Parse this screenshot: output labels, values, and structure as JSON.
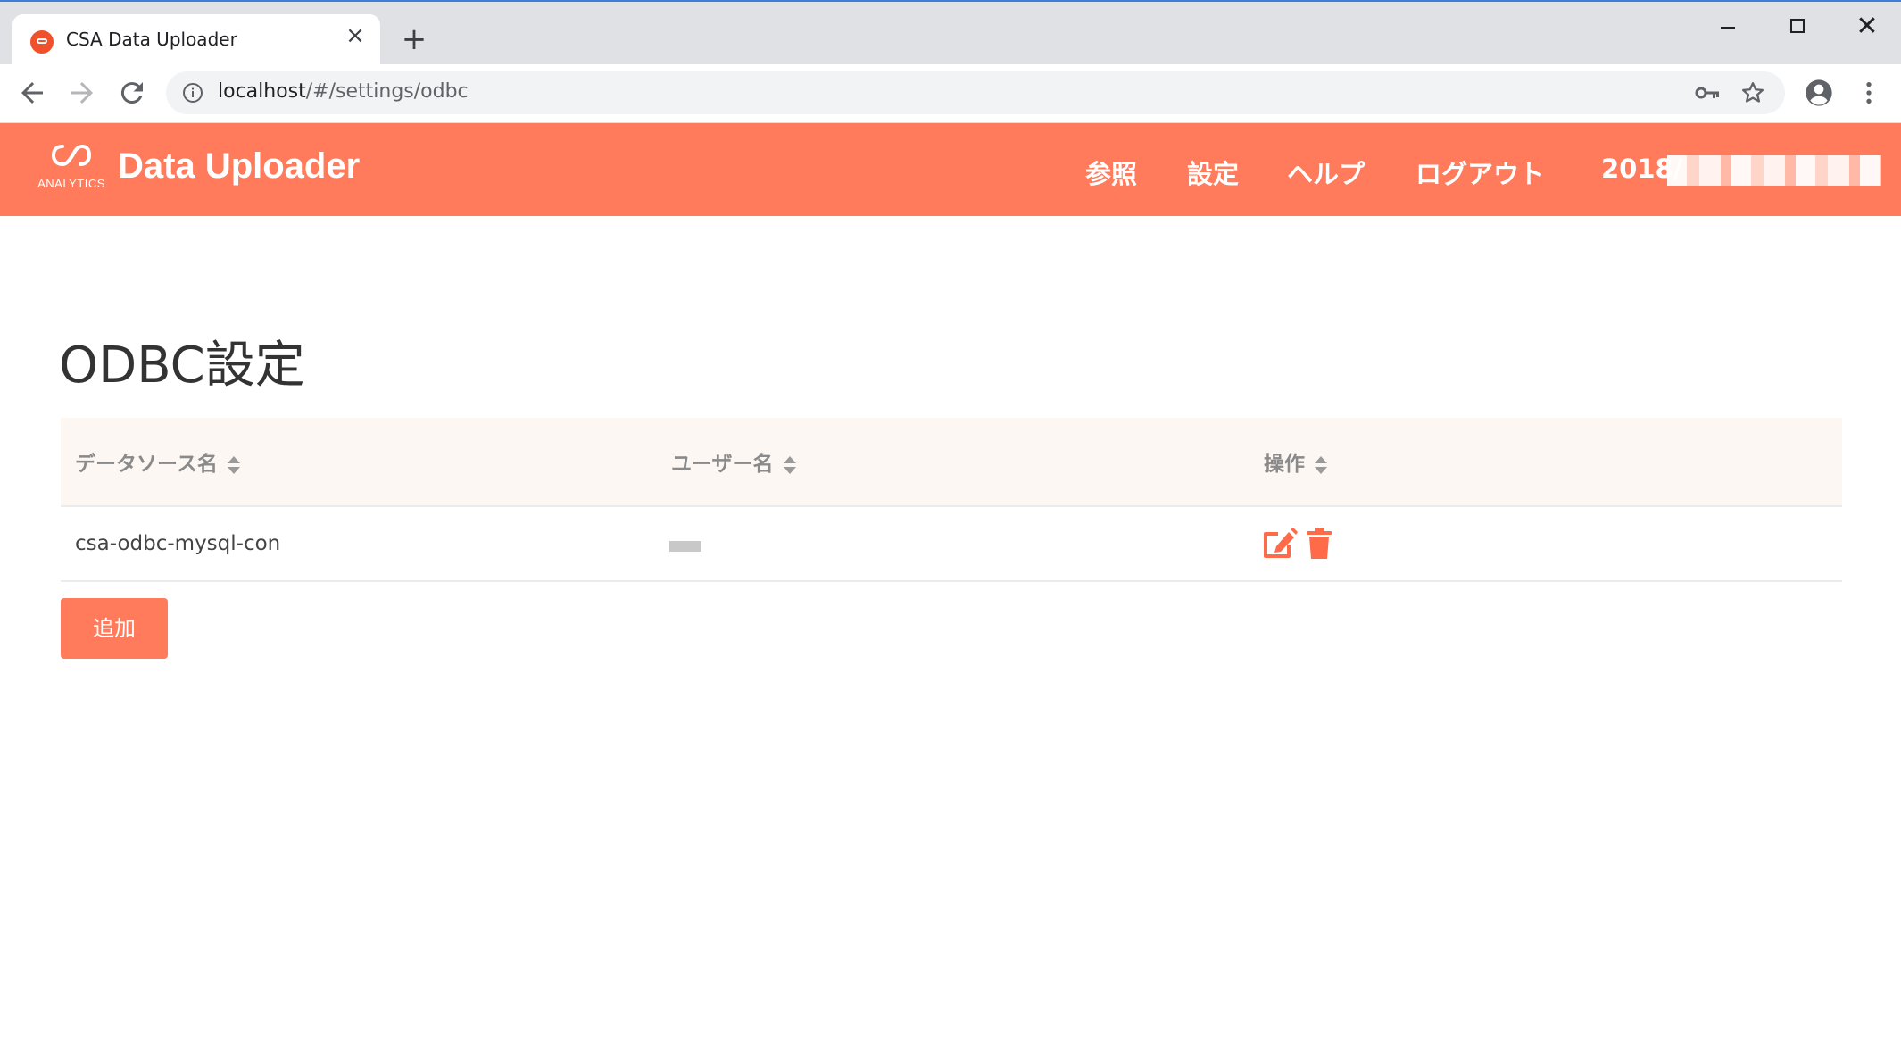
{
  "browser": {
    "tab_title": "CSA Data Uploader",
    "tab_close": "×",
    "new_tab": "+",
    "url_host": "localhost",
    "url_path": "/#/settings/odbc"
  },
  "header": {
    "logo_text": "ANALYTICS",
    "app_title": "Data Uploader",
    "nav": {
      "reference": "参照",
      "settings": "設定",
      "help": "ヘルプ",
      "logout": "ログアウト",
      "date": "2018/"
    }
  },
  "page": {
    "title": "ODBC設定",
    "table": {
      "headers": [
        "データソース名",
        "ユーザー名",
        "操作"
      ],
      "rows": [
        {
          "datasource": "csa-odbc-mysql-con",
          "user": ""
        }
      ]
    },
    "add_label": "追加"
  },
  "colors": {
    "brand": "#ff7b5c",
    "header_bg": "#fdf7f3"
  },
  "icons": [
    "info-icon",
    "key-icon",
    "star-icon",
    "profile-icon",
    "menu-icon",
    "edit-icon",
    "trash-icon",
    "sort-icon"
  ]
}
